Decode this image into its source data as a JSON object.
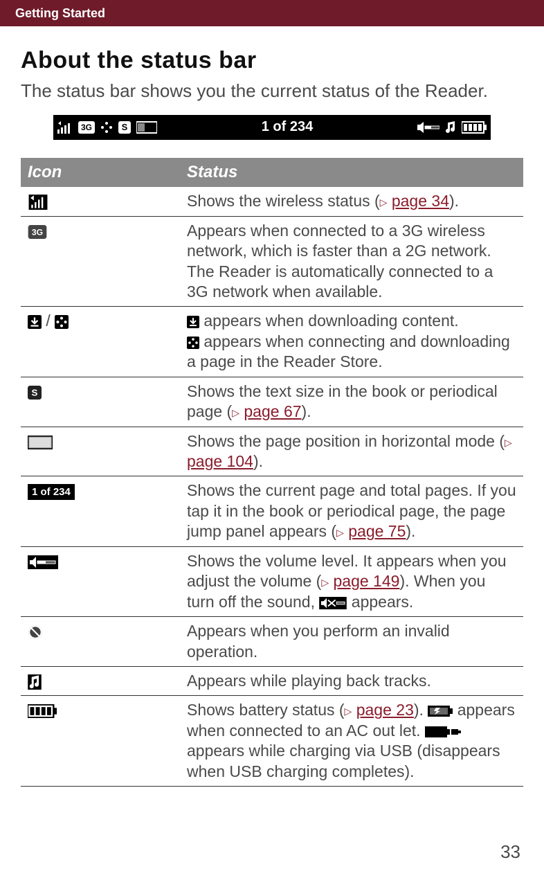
{
  "header": {
    "breadcrumb": "Getting Started"
  },
  "title": "About the status bar",
  "intro": "The status bar shows you the current status of the Reader.",
  "status_bar_sample": {
    "center": "1 of 234",
    "text_size_letter": "S"
  },
  "table": {
    "head_icon": "Icon",
    "head_status": "Status",
    "rows": {
      "wireless": {
        "text_a": "Shows the wireless status (",
        "link": "page 34",
        "text_b": ")."
      },
      "threeg": {
        "text": "Appears when connected to a 3G wireless network, which is faster than a 2G network. The Reader is automatically connected to a 3G network when available."
      },
      "download": {
        "sep": " / ",
        "line1_a": " appears when downloading content.",
        "line2_a": " appears when connecting and downloading a page in the Reader Store."
      },
      "textsize": {
        "text_a": "Shows the text size in the book or periodical page (",
        "link": "page 67",
        "text_b": ")."
      },
      "pagepos": {
        "text_a": "Shows the page position in horizontal mode (",
        "link": "page 104",
        "text_b": ")."
      },
      "pagecount": {
        "icon_label": "1 of 234",
        "text_a": "Shows the current page and total pages. If you tap it in the book or periodical page, the page jump panel appears (",
        "link": "page 75",
        "text_b": ")."
      },
      "volume": {
        "text_a": "Shows the volume level. It appears when you adjust the volume (",
        "link": "page 149",
        "text_b": "). When you turn off the sound, ",
        "text_c": " appears."
      },
      "invalid": {
        "text": "Appears when you perform an invalid operation."
      },
      "playback": {
        "text": "Appears while playing back tracks."
      },
      "battery": {
        "text_a": "Shows battery status (",
        "link": "page 23",
        "text_b": "). ",
        "text_c": " appears when connected to an AC out let. ",
        "text_d": " appears while charging via USB (disappears when USB charging completes)."
      }
    }
  },
  "page_number": "33"
}
